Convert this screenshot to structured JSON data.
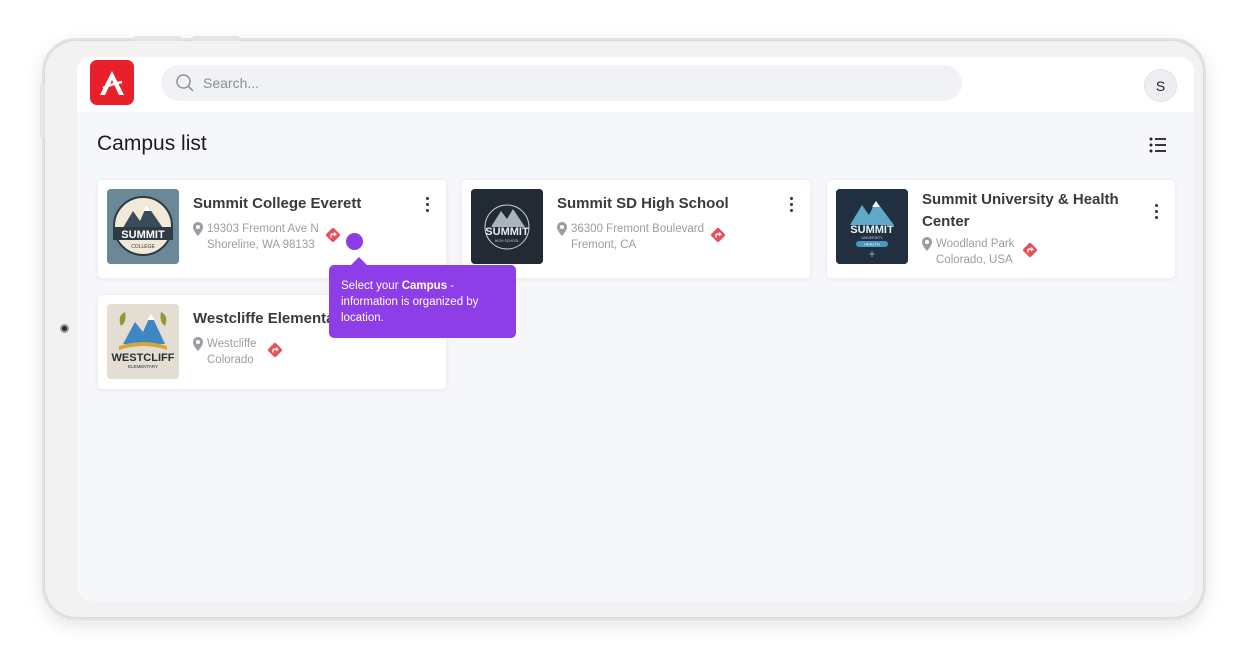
{
  "search": {
    "placeholder": "Search..."
  },
  "user": {
    "initial": "S"
  },
  "page": {
    "title": "Campus list"
  },
  "campuses": [
    {
      "name": "Summit College Everett",
      "address_line1": "19303 Fremont Ave N",
      "address_line2": "Shoreline, WA 98133",
      "logo_text": "SUMMIT",
      "logo_subtext": "COLLEGE"
    },
    {
      "name": "Summit SD High School",
      "address_line1": "36300 Fremont Boulevard",
      "address_line2": "Fremont, CA",
      "logo_text": "SUMMIT",
      "logo_subtext": "HIGH SCHOOL"
    },
    {
      "name_line1": "Summit University & Health",
      "name_line2": "Center",
      "address_line1": "Woodland Park",
      "address_line2": "Colorado, USA",
      "logo_text": "SUMMIT",
      "logo_subtext": "UNIVERSITY",
      "logo_subtext2": "HEALTH"
    },
    {
      "name": "Westcliffe Elementar",
      "address_line1": "Westcliffe",
      "address_line2": "Colorado",
      "logo_text": "WESTCLIFF",
      "logo_subtext": "ELEMENTARY"
    }
  ],
  "tooltip": {
    "prefix": "Select your ",
    "bold": "Campus",
    "suffix": " - information is organized by location."
  },
  "colors": {
    "brand_red": "#e8202a",
    "tooltip_purple": "#8e3ee6",
    "direction_red": "#e8505b"
  }
}
